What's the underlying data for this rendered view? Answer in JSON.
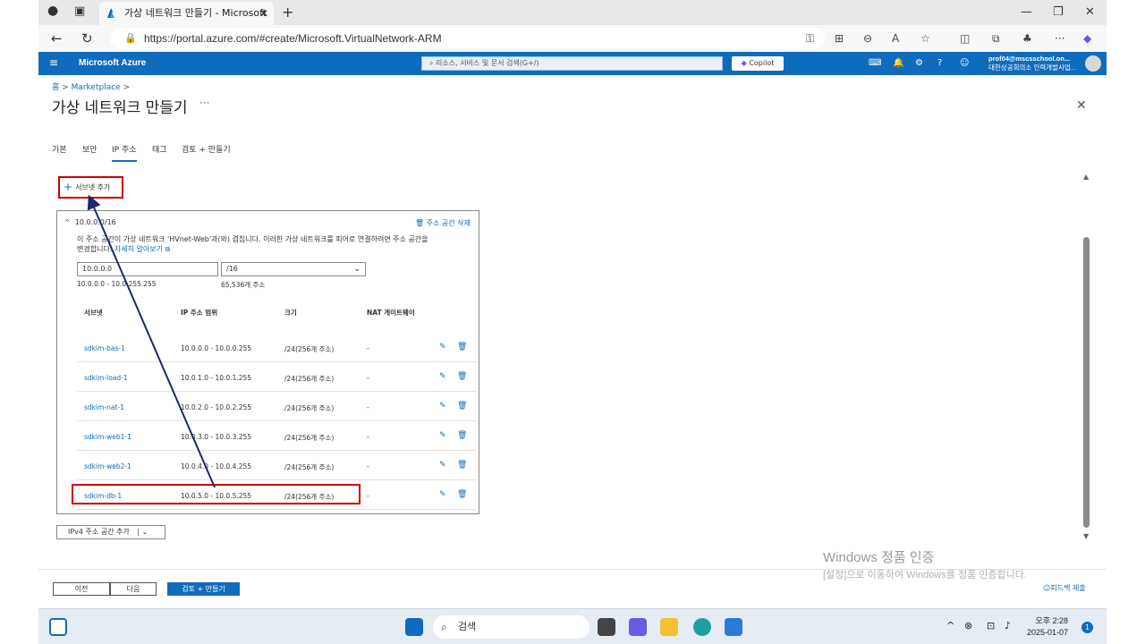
{
  "browser": {
    "tab_title": "가상 네트워크 만들기 - Microsoft",
    "url": "https://portal.azure.com/#create/Microsoft.VirtualNetwork-ARM"
  },
  "azure": {
    "brand": "Microsoft Azure",
    "search_placeholder": "리소스, 서비스 및 문서 검색(G+/)",
    "copilot": "Copilot",
    "account_line1": "prof04@mscsschool.on...",
    "account_line2": "대한상공회의소 인력개발사업..."
  },
  "page": {
    "breadcrumb_home": "홈",
    "breadcrumb_marketplace": "Marketplace",
    "title": "가상 네트워크 만들기",
    "more": "···"
  },
  "tabs": [
    "기본",
    "보안",
    "IP 주소",
    "태그",
    "검토 + 만들기"
  ],
  "add_subnet": "서브넷 추가",
  "address_space": {
    "cidr": "10.0.0.0/16",
    "delete": "주소 공간 삭제",
    "info_line1": "이 주소 공간이 가상 네트워크 'HVnet-Web'과(와) 겹칩니다. 이러한 가상 네트워크를 피어로 연결하려면 주소 공간을",
    "info_line2": "변경합니다.",
    "learn_more": "자세히 알아보기",
    "ip": "10.0.0.0",
    "prefix": "/16",
    "range": "10.0.0.0 - 10.0.255.255",
    "count": "65,536개 주소"
  },
  "subnet_table": {
    "headers": [
      "서브넷",
      "IP 주소 범위",
      "크기",
      "NAT 게이트웨이"
    ],
    "rows": [
      {
        "name": "sdkim-bas-1",
        "range": "10.0.0.0 - 10.0.0.255",
        "size": "/24(256개 주소)",
        "nat": "-"
      },
      {
        "name": "sdkim-load-1",
        "range": "10.0.1.0 - 10.0.1.255",
        "size": "/24(256개 주소)",
        "nat": "-"
      },
      {
        "name": "sdkim-nat-1",
        "range": "10.0.2.0 - 10.0.2.255",
        "size": "/24(256개 주소)",
        "nat": "-"
      },
      {
        "name": "sdkim-web1-1",
        "range": "10.0.3.0 - 10.0.3.255",
        "size": "/24(256개 주소)",
        "nat": "-"
      },
      {
        "name": "sdkim-web2-1",
        "range": "10.0.4.0 - 10.0.4.255",
        "size": "/24(256개 주소)",
        "nat": "-"
      },
      {
        "name": "sdkim-db-1",
        "range": "10.0.5.0 - 10.0.5.255",
        "size": "/24(256개 주소)",
        "nat": "-"
      }
    ]
  },
  "add_ipv4": "IPv4 주소 공간 추가",
  "footer": {
    "prev": "이전",
    "next": "다음",
    "review": "검토 + 만들기",
    "feedback": "피드백 제출"
  },
  "watermark": {
    "line1": "Windows 정품 인증",
    "line2": "[설정]으로 이동하여 Windows를 정품 인증합니다."
  },
  "taskbar": {
    "search": "검색",
    "time": "오후 2:28",
    "date": "2025-01-07",
    "notifications": "1"
  },
  "colors": {
    "accent": "#0f6cbd",
    "highlight": "#cc0000",
    "arrow": "#1a2a6c"
  }
}
